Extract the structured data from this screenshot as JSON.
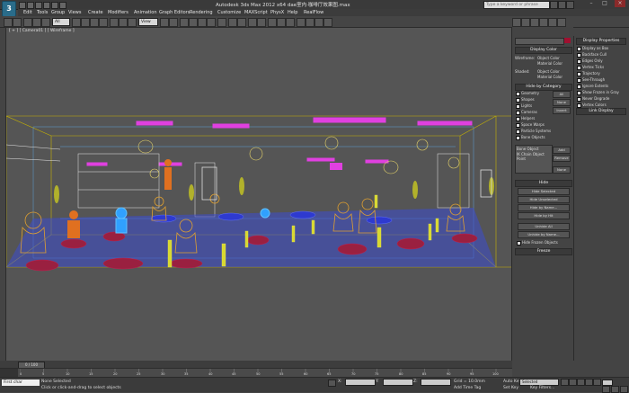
{
  "app": {
    "logo": "3",
    "title": "Autodesk 3ds Max  2012 x64    dae室内·咖啡厅效果图.max"
  },
  "search": {
    "placeholder": "Type a keyword or phrase"
  },
  "menu": {
    "items": [
      "Edit",
      "Tools",
      "Group",
      "Views",
      "Create",
      "Modifiers",
      "Animation",
      "Graph Editors",
      "Rendering",
      "Customize",
      "MAXScript",
      "PhysX",
      "Help",
      "RealFlow"
    ]
  },
  "toolbar": {
    "selection_filter": "All",
    "ref_coord": "View"
  },
  "viewport": {
    "label": "[ + ] [ Camera01 ] [ Wireframe ]"
  },
  "command_panel": {
    "display_color": "Display Color",
    "wireframe": "Wireframe:",
    "object_color": "Object Color",
    "material_color": "Material Color",
    "shaded": "Shaded:",
    "hide_by_category": "Hide by Category",
    "categories": [
      "Geometry",
      "Shapes",
      "Lights",
      "Cameras",
      "Helpers",
      "Space Warps",
      "Particle Systems",
      "Bone Objects"
    ],
    "all": "All",
    "none": "None",
    "invert": "Invert",
    "list_items": [
      "Bone Object",
      "IK Chain Object",
      "Point"
    ],
    "add": "Add",
    "remove": "Remove",
    "hide": "Hide",
    "hide_selected": "Hide Selected",
    "hide_unselected": "Hide Unselected",
    "hide_by_name": "Hide by Name...",
    "hide_by_hit": "Hide by Hit",
    "unhide_all": "Unhide All",
    "unhide_by_name": "Unhide by Name...",
    "hide_frozen": "Hide Frozen Objects",
    "freeze": "Freeze"
  },
  "display_properties": {
    "title": "Display Properties",
    "items": [
      "Display as Box",
      "Backface Cull",
      "Edges Only",
      "Vertex Ticks",
      "Trajectory",
      "See-Through",
      "Ignore Extents",
      "Show Frozen in Gray",
      "Never Degrade",
      "Vertex Colors"
    ],
    "link_display": "Link Display"
  },
  "timeline": {
    "frame_counter": "0 / 100",
    "ticks": [
      "0",
      "5",
      "10",
      "15",
      "20",
      "25",
      "30",
      "35",
      "40",
      "45",
      "50",
      "55",
      "60",
      "65",
      "70",
      "75",
      "80",
      "85",
      "90",
      "95",
      "100"
    ]
  },
  "status": {
    "mode": "First  char",
    "selection": "None Selected",
    "prompt": "Click or click-and-drag to select objects",
    "x_label": "X:",
    "y_label": "Y:",
    "z_label": "Z:",
    "grid": "Grid = 10.0mm",
    "autokey": "Auto Key",
    "selected": "Selected",
    "set_key": "Set Key",
    "key_filters": "Key Filters...",
    "add_time_tag": "Add Time Tag"
  }
}
